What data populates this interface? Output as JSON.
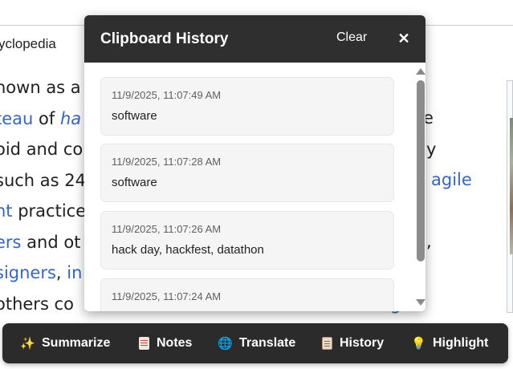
{
  "background": {
    "tagline": "yclopedia",
    "lines": [
      {
        "plain_a": "nown as a",
        "link": "",
        "plain_b": ""
      },
      {
        "plain_a": "",
        "link": "teau",
        "plain_b": " of ",
        "link2": "ha"
      },
      {
        "plain_a": "oid and co",
        "link": "",
        "plain_b": ""
      },
      {
        "plain_a": "such as 24",
        "link": "",
        "plain_b": ""
      },
      {
        "plain_a": "",
        "link": "nt",
        "plain_b": " practice"
      },
      {
        "plain_a": "",
        "link": "ers",
        "plain_b": " and ot"
      },
      {
        "plain_a": "",
        "link": "signers",
        "plain_b": ", ",
        "link2": "in"
      },
      {
        "plain_a": " others co",
        "link": "",
        "plain_b": ""
      }
    ],
    "right_fragments": {
      "e": "e",
      "y": "y",
      "agile": "agile",
      "comma": ",",
      "tail": "g"
    }
  },
  "popup": {
    "title": "Clipboard History",
    "clear_label": "Clear",
    "close_glyph": "✕",
    "entries": [
      {
        "time": "11/9/2025, 11:07:49 AM",
        "text": "software"
      },
      {
        "time": "11/9/2025, 11:07:28 AM",
        "text": "software"
      },
      {
        "time": "11/9/2025, 11:07:26 AM",
        "text": "hack day, hackfest, datathon"
      },
      {
        "time": "11/9/2025, 11:07:24 AM",
        "text": ""
      }
    ]
  },
  "toolbar": {
    "buttons": [
      {
        "label": "Summarize",
        "icon": "sparkles-icon",
        "glyph": "✨"
      },
      {
        "label": "Notes",
        "icon": "notes-icon",
        "glyph": ""
      },
      {
        "label": "Translate",
        "icon": "globe-icon",
        "glyph": "🌐"
      },
      {
        "label": "History",
        "icon": "clipboard-icon",
        "glyph": ""
      },
      {
        "label": "Highlight",
        "icon": "lightbulb-icon",
        "glyph": "💡"
      }
    ]
  },
  "colors": {
    "link": "#3366cc",
    "header_bg": "#2f2f2f",
    "toolbar_bg": "#2b2b2b",
    "entry_bg": "#f5f5f5"
  }
}
